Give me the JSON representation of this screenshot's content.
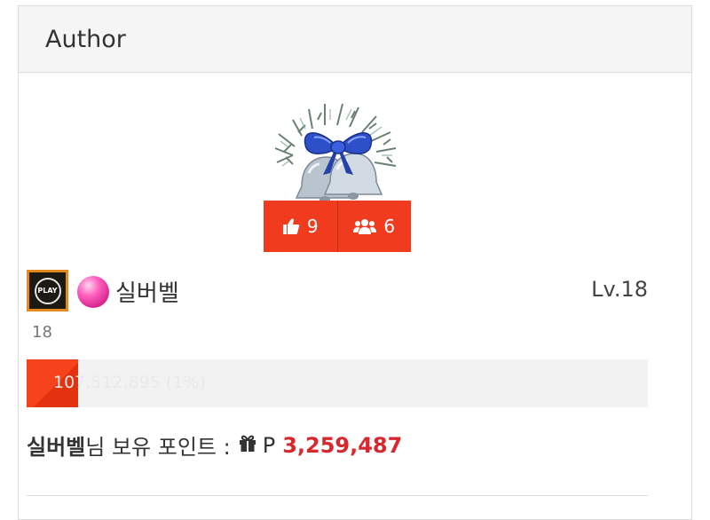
{
  "panel": {
    "title": "Author"
  },
  "avatar": {
    "icon": "christmas-bell-icon"
  },
  "stats": {
    "likes": {
      "icon": "thumbs-up-icon",
      "count": "9"
    },
    "followers": {
      "icon": "users-icon",
      "count": "6"
    },
    "color": "#f03b1e"
  },
  "user": {
    "badge_text": "PLAY",
    "name": "실버벨",
    "level": "Lv.18",
    "level_number": "18"
  },
  "xp": {
    "text": "107,512,895 (1%)",
    "percent": 1,
    "color": "#f7431c"
  },
  "points": {
    "name": "실버벨",
    "label": "님 보유 포인트 :",
    "unit": "P",
    "value": "3,259,487",
    "value_color": "#d7282f"
  }
}
